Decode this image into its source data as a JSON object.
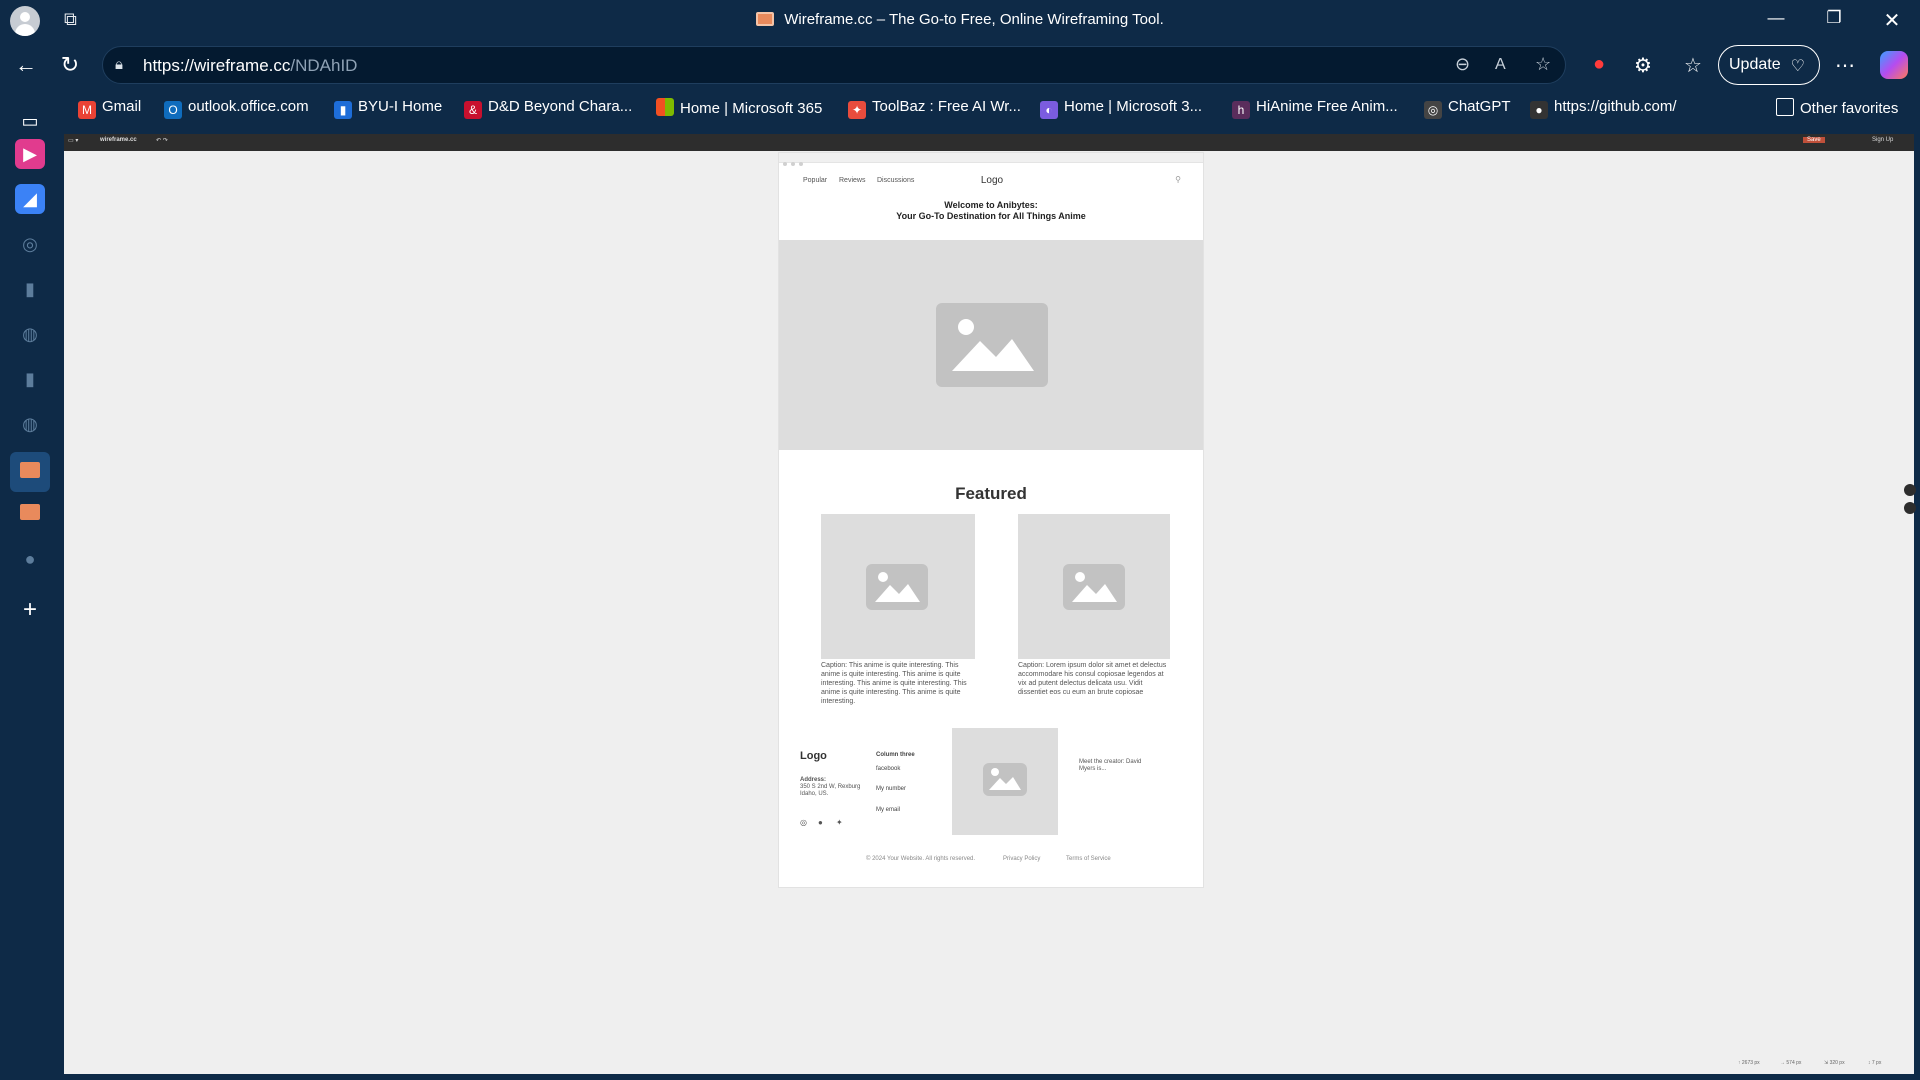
{
  "window": {
    "title": "Wireframe.cc – The Go-to Free, Online Wireframing Tool.",
    "controls": [
      "minimize",
      "restore",
      "close"
    ]
  },
  "address": {
    "url_host": "https://wireframe.cc",
    "url_path": "/NDAhID",
    "update_label": "Update"
  },
  "favorites": [
    {
      "label": "Gmail",
      "icon": "gmail-icon",
      "color": "#ea4335"
    },
    {
      "label": "outlook.office.com",
      "icon": "outlook-icon",
      "color": "#0f6cbd"
    },
    {
      "label": "BYU-I Home",
      "icon": "byui-icon",
      "color": "#1e6dd8"
    },
    {
      "label": "D&D Beyond Chara...",
      "icon": "dndbeyond-icon",
      "color": "#c8102e"
    },
    {
      "label": "Home | Microsoft 365",
      "icon": "microsoft-icon",
      "color": "#f25022"
    },
    {
      "label": "ToolBaz : Free AI Wr...",
      "icon": "toolbaz-icon",
      "color": "#e84c3d"
    },
    {
      "label": "Home | Microsoft 3...",
      "icon": "m365-icon",
      "color": "#7b5ce0"
    },
    {
      "label": "HiAnime Free Anim...",
      "icon": "hianime-icon",
      "color": "#5a2d5c"
    },
    {
      "label": "ChatGPT",
      "icon": "chatgpt-icon",
      "color": "#444"
    },
    {
      "label": "https://github.com/",
      "icon": "github-icon",
      "color": "#333"
    }
  ],
  "other_favorites": "Other favorites",
  "app": {
    "brand": "wireframe.cc",
    "save": "Save",
    "signup": "Sign Up"
  },
  "wireframe": {
    "nav": [
      "Popular",
      "Reviews",
      "Discussions"
    ],
    "logo": "Logo",
    "welcome_line1": "Welcome to Anibytes:",
    "welcome_line2": "Your Go-To Destination for All Things Anime",
    "featured": "Featured",
    "caption1": "Caption: This anime is quite interesting. This anime is quite interesting. This anime is quite interesting. This anime is quite interesting. This anime is quite interesting. This anime is quite interesting.",
    "caption2": "Caption: Lorem ipsum dolor sit amet et delectus accommodare his consul copiosae legendos at vix ad putent delectus delicata usu. Vidit dissentiet eos cu eum an brute copiosae",
    "footer_logo": "Logo",
    "address_label": "Address:",
    "address_text": "350 S 2nd W, Rexburg Idaho, US.",
    "column_title": "Column three",
    "column_links": [
      "facebook",
      "My number",
      "My email"
    ],
    "meet_creator": "Meet the creator: David Myers is...",
    "copyright": "© 2024 Your Website. All rights reserved.",
    "privacy": "Privacy Policy",
    "terms": "Terms of Service"
  },
  "statusbar": [
    "↑ 2673 px",
    "→ 574 px",
    "⇲ 320 px",
    "↕ 7 px"
  ]
}
